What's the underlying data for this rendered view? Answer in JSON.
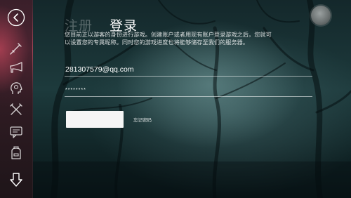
{
  "tabs": {
    "register_label": "注册",
    "login_label": "登录"
  },
  "notice": {
    "text": "您目前正以游客的身份进行游戏。创建账户或者用现有账户登录游戏之后，您就可以设置您的专属昵称。同时您的游戏进度也将能够储存至我们的服务器。"
  },
  "form": {
    "email_value": "281307579@qq.com",
    "password_value": "********",
    "login_button_label": "",
    "forgot_password_label": "忘记密码"
  },
  "sidebar": {
    "icons": [
      "back-icon",
      "sword-icon",
      "horn-icon",
      "head-profile-icon",
      "crossed-tools-icon",
      "chat-icon",
      "backpack-icon",
      "download-arrow-icon"
    ]
  },
  "colors": {
    "sidebar_accent": "#a8435c",
    "background": "#1d3a3c",
    "text": "#ffffff",
    "button_fill": "#f5f5f5"
  }
}
